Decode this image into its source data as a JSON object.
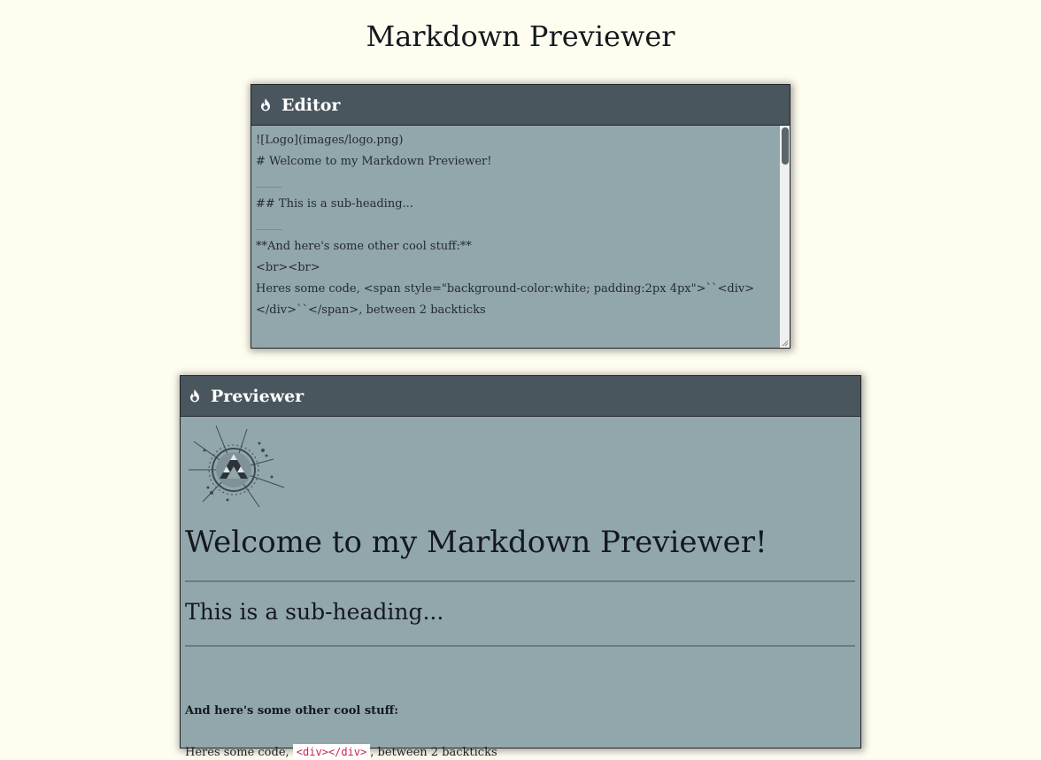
{
  "page": {
    "title": "Markdown Previewer"
  },
  "editor": {
    "title": "Editor",
    "icon": "fire-icon",
    "lines": [
      "![Logo](images/logo.png)",
      "# Welcome to my Markdown Previewer!",
      "______",
      "## This is a sub-heading...",
      "______",
      "**And here's some other cool stuff:**",
      "<br><br>",
      "Heres some code, <span style=\"background-color:white; padding:2px 4px\">``<div>",
      "</div>``</span>, between 2 backticks"
    ]
  },
  "previewer": {
    "title": "Previewer",
    "icon": "fire-icon",
    "logo_alt": "Logo",
    "h1": "Welcome to my Markdown Previewer!",
    "h2": "This is a sub-heading...",
    "bold_text": "And here's some other cool stuff:",
    "code_prefix": "Heres some code, ",
    "code_snippet": "<div></div>",
    "code_suffix": ", between 2 backticks"
  },
  "colors": {
    "background": "#fffdf0",
    "toolbar": "#4a565e",
    "panel": "#92a7ab",
    "code_text": "#c7254e"
  }
}
